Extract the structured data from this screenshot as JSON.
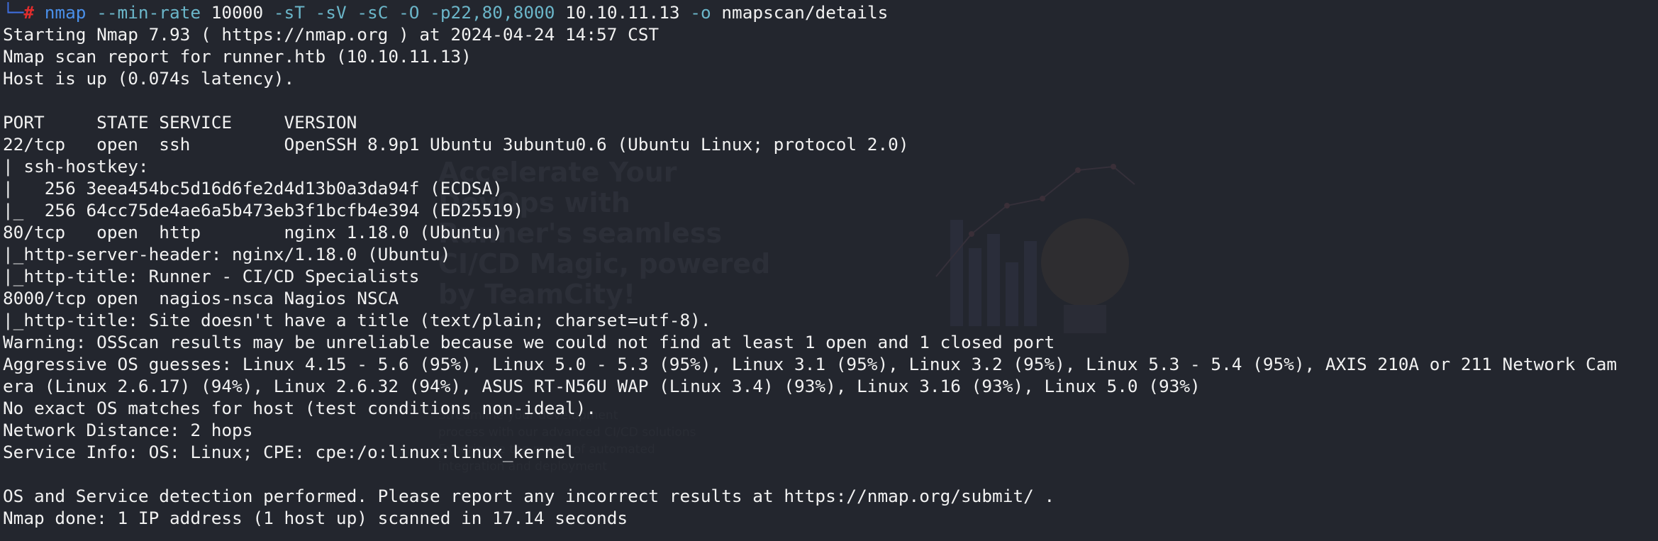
{
  "prompt": {
    "corner": "└─",
    "symbol": "#"
  },
  "command": {
    "program": "nmap",
    "opt1": "--min-rate",
    "val1": "10000",
    "opt2": "-sT",
    "opt3": "-sV",
    "opt4": "-sC",
    "opt5": "-O",
    "opt6": "-p22,80,8000",
    "target": "10.10.11.13",
    "opt7": "-o",
    "outfile": "nmapscan/details"
  },
  "output": [
    "Starting Nmap 7.93 ( https://nmap.org ) at 2024-04-24 14:57 CST",
    "Nmap scan report for runner.htb (10.10.11.13)",
    "Host is up (0.074s latency).",
    "",
    "PORT     STATE SERVICE     VERSION",
    "22/tcp   open  ssh         OpenSSH 8.9p1 Ubuntu 3ubuntu0.6 (Ubuntu Linux; protocol 2.0)",
    "| ssh-hostkey: ",
    "|   256 3eea454bc5d16d6fe2d4d13b0a3da94f (ECDSA)",
    "|_  256 64cc75de4ae6a5b473eb3f1bcfb4e394 (ED25519)",
    "80/tcp   open  http        nginx 1.18.0 (Ubuntu)",
    "|_http-server-header: nginx/1.18.0 (Ubuntu)",
    "|_http-title: Runner - CI/CD Specialists",
    "8000/tcp open  nagios-nsca Nagios NSCA",
    "|_http-title: Site doesn't have a title (text/plain; charset=utf-8).",
    "Warning: OSScan results may be unreliable because we could not find at least 1 open and 1 closed port",
    "Aggressive OS guesses: Linux 4.15 - 5.6 (95%), Linux 5.0 - 5.3 (95%), Linux 3.1 (95%), Linux 3.2 (95%), Linux 5.3 - 5.4 (95%), AXIS 210A or 211 Network Cam",
    "era (Linux 2.6.17) (94%), Linux 2.6.32 (94%), ASUS RT-N56U WAP (Linux 3.4) (93%), Linux 3.16 (93%), Linux 5.0 (93%)",
    "No exact OS matches for host (test conditions non-ideal).",
    "Network Distance: 2 hops",
    "Service Info: OS: Linux; CPE: cpe:/o:linux:linux_kernel",
    "",
    "OS and Service detection performed. Please report any incorrect results at https://nmap.org/submit/ .",
    "Nmap done: 1 IP address (1 host up) scanned in 17.14 seconds"
  ],
  "wallpaper": {
    "headline": [
      "Accelerate Your",
      "DevOps with",
      "Runner's seamless",
      "CI/CD Magic, powered",
      "by TeamCity!"
    ],
    "body": [
      "Streamline your development",
      "process with our advanced CI/CD solutions",
      "Experience the magic of automated",
      "integration and deployment"
    ]
  },
  "colors": {
    "background": "#23262e",
    "text": "#f1f1f1",
    "prompt_hash": "#e02d2d",
    "command": "#4a8fe8",
    "option": "#6bb6c9"
  }
}
